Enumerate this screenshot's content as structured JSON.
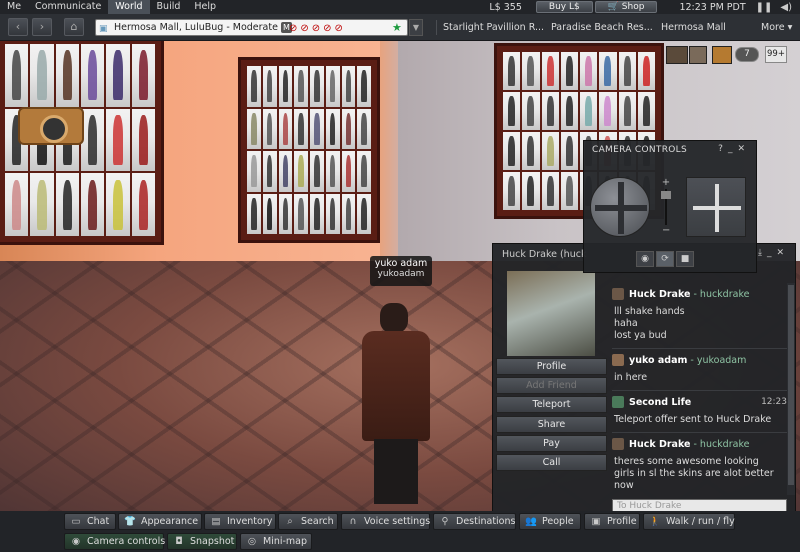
{
  "menubar": {
    "items": [
      "Me",
      "Communicate",
      "World",
      "Build",
      "Help"
    ],
    "balance": "L$ 355",
    "buy_label": "Buy L$",
    "shop_label": "Shop",
    "clock": "12:23 PM PDT"
  },
  "navbar": {
    "location": "Hermosa Mall, LuluBug - Moderate",
    "maturity_badge": "M",
    "favorites": [
      "Starlight Pavillion R...",
      "Paradise Beach Res...",
      "Hermosa Mall"
    ],
    "more_label": "More",
    "notifications_count": "7",
    "chat_count": "99+"
  },
  "scene": {
    "avatar_name": "yuko adam",
    "avatar_username": "yukoadam"
  },
  "camera_controls": {
    "title": "CAMERA CONTROLS",
    "zoom_plus": "+",
    "zoom_minus": "−"
  },
  "im": {
    "title": "Huck Drake (huck",
    "buttons": [
      "Profile",
      "Add Friend",
      "Teleport",
      "Share",
      "Pay",
      "Call"
    ],
    "messages": [
      {
        "name": "Huck Drake",
        "user": "- huckdrake",
        "time": "",
        "lines": [
          "lll shake hands",
          "haha",
          "lost ya bud"
        ]
      },
      {
        "name": "yuko adam",
        "user": "- yukoadam",
        "time": "",
        "lines": [
          "in here"
        ]
      },
      {
        "name": "Second Life",
        "user": "",
        "time": "12:23",
        "lines": [
          "Teleport offer sent to Huck Drake"
        ]
      },
      {
        "name": "Huck Drake",
        "user": "- huckdrake",
        "time": "",
        "lines": [
          "theres some awesome looking",
          "girls in sl  the skins are alot better",
          "now"
        ]
      }
    ],
    "input_placeholder": "To Huck Drake"
  },
  "toolbar": {
    "chat": "Chat",
    "appearance": "Appearance",
    "inventory": "Inventory",
    "search": "Search",
    "voice": "Voice settings",
    "destinations": "Destinations",
    "people": "People",
    "profile": "Profile",
    "walk": "Walk / run / fly",
    "camera": "Camera controls",
    "snapshot": "Snapshot",
    "minimap": "Mini-map"
  }
}
